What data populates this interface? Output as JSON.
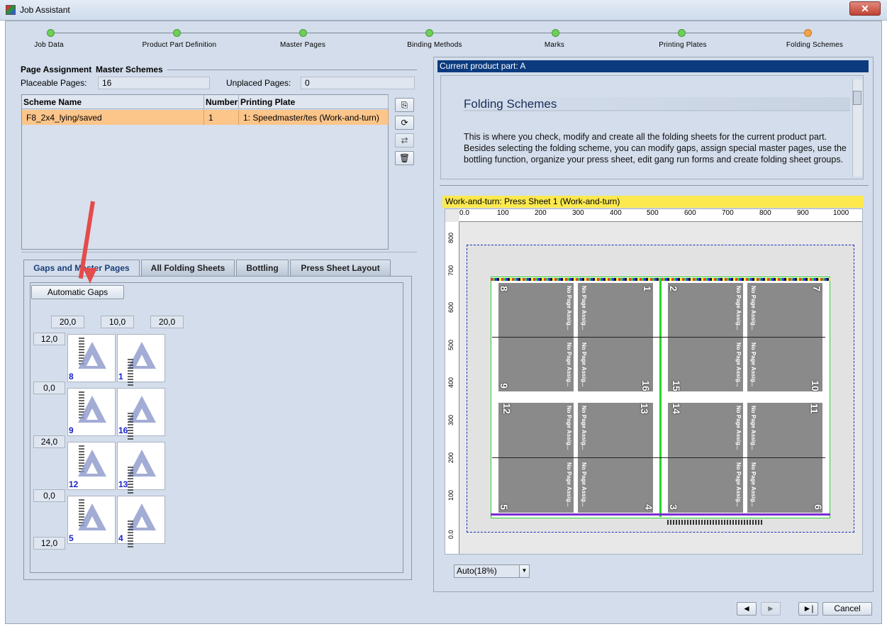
{
  "window": {
    "title": "Job Assistant",
    "close": "✕"
  },
  "steps": [
    {
      "label": "Job Data",
      "status": "done"
    },
    {
      "label": "Product Part Definition",
      "status": "done"
    },
    {
      "label": "Master Pages",
      "status": "done"
    },
    {
      "label": "Binding Methods",
      "status": "done"
    },
    {
      "label": "Marks",
      "status": "done"
    },
    {
      "label": "Printing Plates",
      "status": "done"
    },
    {
      "label": "Folding Schemes",
      "status": "active"
    }
  ],
  "left": {
    "page_assignment_title": "Page Assignment",
    "master_schemes_title": "Master Schemes",
    "placeable_label": "Placeable Pages:",
    "placeable_value": "16",
    "unplaced_label": "Unplaced Pages:",
    "unplaced_value": "0",
    "table": {
      "headers": [
        "Scheme Name",
        "Number",
        "Printing Plate"
      ],
      "rows": [
        [
          "F8_2x4_lying/saved",
          "1",
          "1: Speedmaster/tes (Work-and-turn)"
        ]
      ]
    },
    "tabs": [
      "Gaps and Master Pages",
      "All Folding Sheets",
      "Bottling",
      "Press Sheet Layout"
    ],
    "auto_gaps_label": "Automatic Gaps",
    "col_gaps": [
      "20,0",
      "10,0",
      "20,0"
    ],
    "row_gaps": [
      "12,0",
      "0,0",
      "24,0",
      "0,0",
      "12,0"
    ],
    "thumbs": [
      [
        "8",
        "1"
      ],
      [
        "9",
        "16"
      ],
      [
        "12",
        "13"
      ],
      [
        "5",
        "4"
      ]
    ]
  },
  "right": {
    "header": "Current product part: A",
    "help_title": "Folding Schemes",
    "help_text": "This is where you check, modify and create all the folding sheets for the current product part. Besides selecting the folding scheme, you can modify gaps, assign special master pages, use the bottling function, organize your press sheet, edit gang run forms and create folding sheet groups.",
    "sheet_header": "Work-and-turn:  Press Sheet 1 (Work-and-turn)",
    "ruler_top": [
      "0.0",
      "100",
      "200",
      "300",
      "400",
      "500",
      "600",
      "700",
      "800",
      "900",
      "1000"
    ],
    "ruler_left": [
      "800",
      "700",
      "600",
      "500",
      "400",
      "300",
      "200",
      "100",
      "0.0"
    ],
    "pages": [
      {
        "num": "8",
        "label": "No Page Assig..."
      },
      {
        "num": "1",
        "label": "No Page Assig..."
      },
      {
        "num": "2",
        "label": "No Page Assig..."
      },
      {
        "num": "7",
        "label": "No Page Assig..."
      },
      {
        "num": "9",
        "label": "No Page Assig..."
      },
      {
        "num": "16",
        "label": "No Page Assig..."
      },
      {
        "num": "15",
        "label": "No Page Assig..."
      },
      {
        "num": "10",
        "label": "No Page Assig..."
      },
      {
        "num": "12",
        "label": "No Page Assig..."
      },
      {
        "num": "13",
        "label": "No Page Assig..."
      },
      {
        "num": "14",
        "label": "No Page Assig..."
      },
      {
        "num": "11",
        "label": "No Page Assig..."
      },
      {
        "num": "5",
        "label": "No Page Assig..."
      },
      {
        "num": "4",
        "label": "No Page Assig..."
      },
      {
        "num": "3",
        "label": "No Page Assig..."
      },
      {
        "num": "6",
        "label": "No Page Assig..."
      }
    ],
    "zoom": "Auto(18%)"
  },
  "footer": {
    "back": "◄",
    "forward": "►",
    "last": "►|",
    "cancel": "Cancel"
  }
}
